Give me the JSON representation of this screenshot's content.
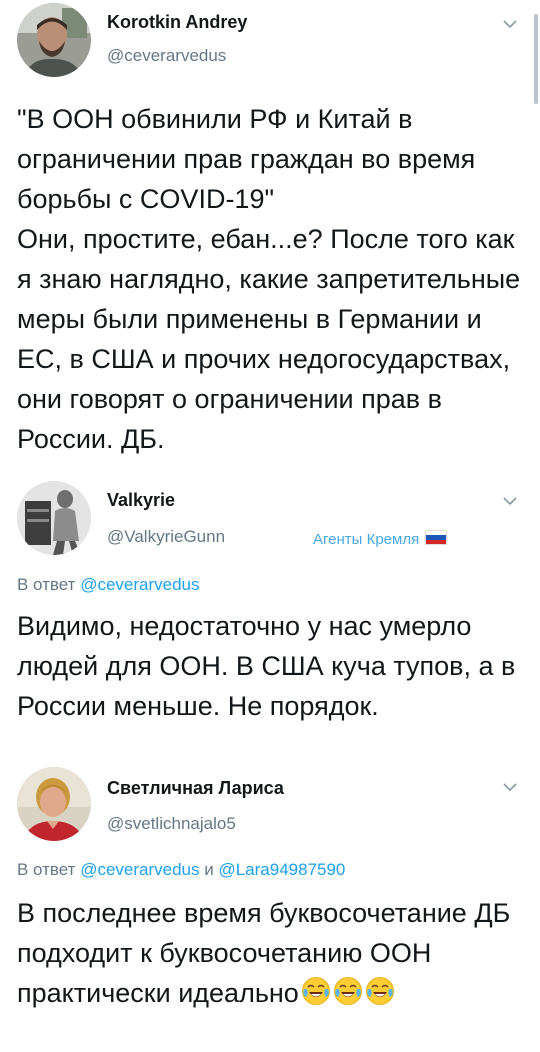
{
  "tweets": [
    {
      "author_name": "Korotkin Andrey",
      "handle": "@ceverarvedus",
      "avatar_icon": "user-photo",
      "text": "\"В ООН обвинили РФ и Китай в ограничении прав граждан во время борьбы с COVID-19\"\nОни, простите, ебан...е? После того как я знаю наглядно, какие запретительные меры были применены в Германии и ЕС, в США и прочих недогосударствах, они говорят о ограничении прав в России. ДБ."
    },
    {
      "author_name": "Valkyrie",
      "handle": "@ValkyrieGunn",
      "tag_text": "Агенты Кремля",
      "tag_flag_icon": "russia-flag-icon",
      "reply_prefix": "В ответ",
      "reply_mention_1": "@ceverarvedus",
      "text": "Видимо, недостаточно у нас умерло людей для ООН. В США куча тупов, а в России меньше. Не порядок."
    },
    {
      "author_name": "Светличная Лариса",
      "handle": "@svetlichnajalo5",
      "reply_prefix": "В ответ",
      "reply_mention_1": "@ceverarvedus",
      "reply_and": "и",
      "reply_mention_2": "@Lara94987590",
      "text": "В последнее время буквосочетание ДБ подходит к буквосочетанию ООН практически идеально",
      "emoji_icons": [
        "face-with-tears-of-joy",
        "face-with-tears-of-joy",
        "face-with-tears-of-joy"
      ]
    }
  ],
  "colors": {
    "text": "#14171a",
    "secondary": "#657786",
    "link": "#1da1f2",
    "tag": "#4aa8e0"
  }
}
